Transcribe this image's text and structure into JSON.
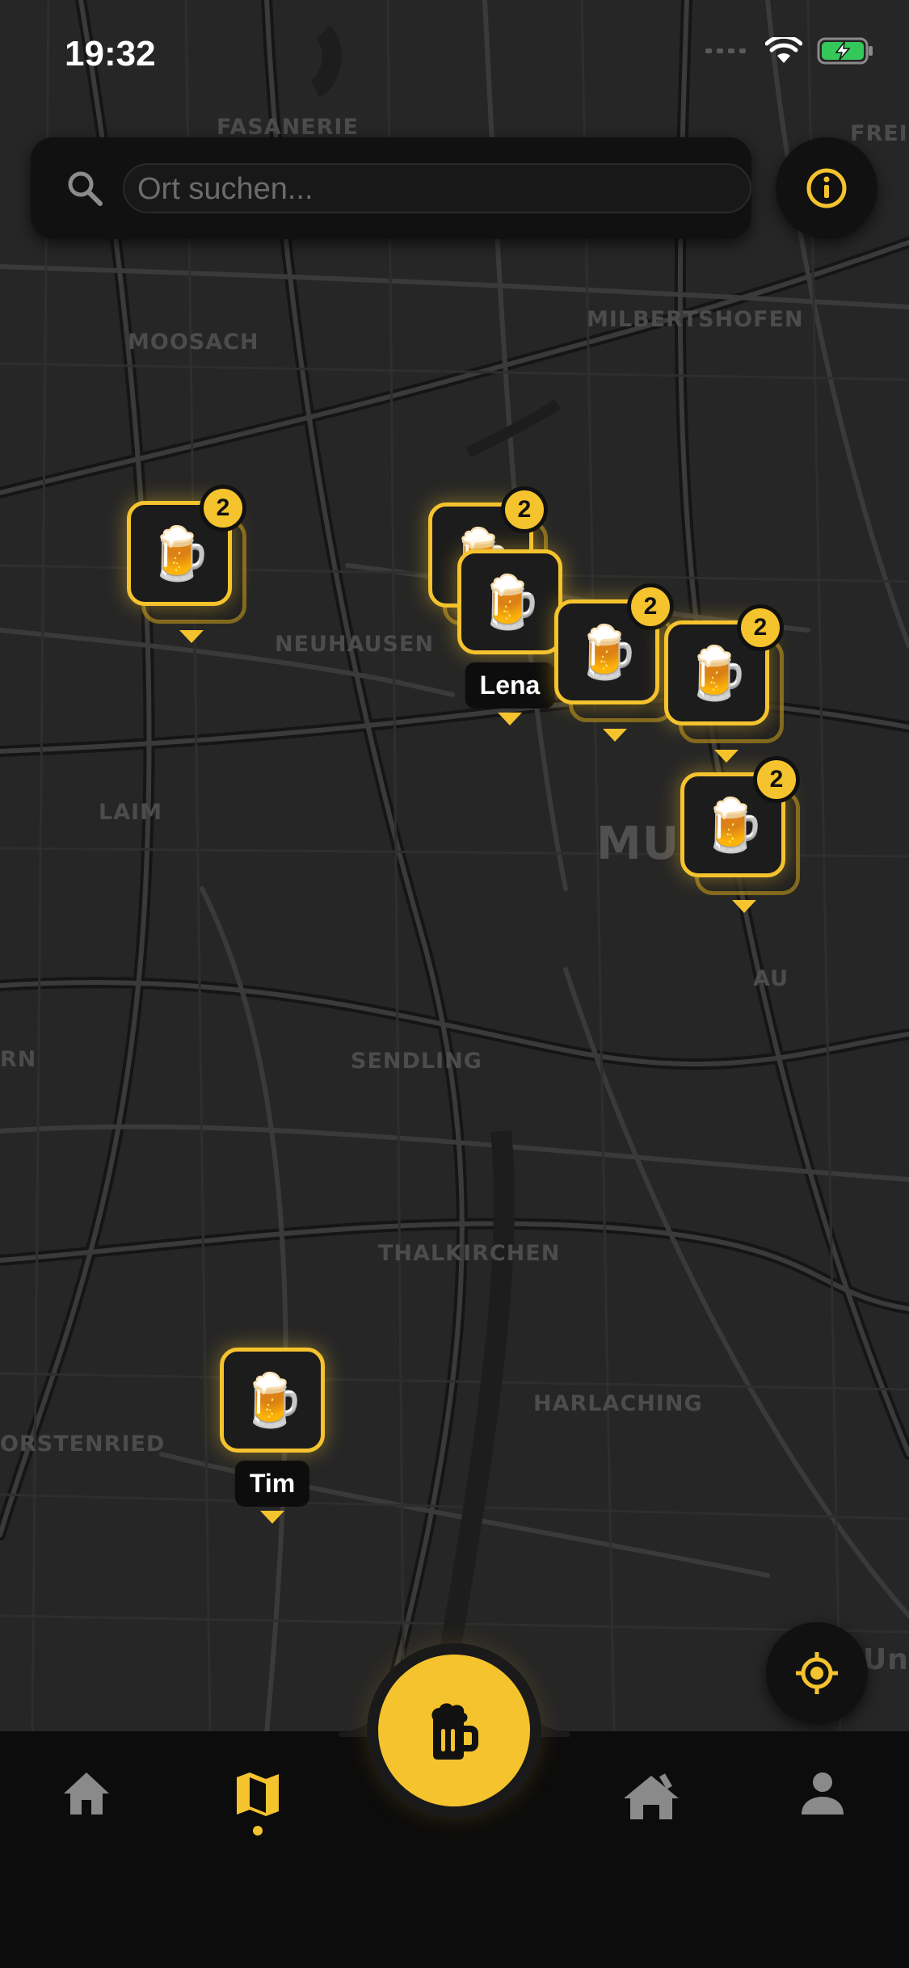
{
  "status_bar": {
    "time": "19:32"
  },
  "search": {
    "placeholder": "Ort suchen..."
  },
  "districts": {
    "fasanerie": "FASANERIE",
    "frei": "FREI",
    "milbertshofen": "MILBERTSHOFEN",
    "moosach": "MOOSACH",
    "neuhausen": "NEUHAUSEN",
    "laim": "LAIM",
    "mu": "MU",
    "au": "AU",
    "rn": "RN",
    "sendling": "SENDLING",
    "thalkirchen": "THALKIRCHEN",
    "harlaching": "HARLACHING",
    "orstenried": "ORSTENRIED",
    "unt": "Unt"
  },
  "markers": [
    {
      "emoji": "🍺",
      "badge": "2"
    },
    {
      "emoji": "🍺",
      "badge": "2"
    },
    {
      "emoji": "🍺",
      "name": "Lena"
    },
    {
      "emoji": "🍺",
      "badge": "2"
    },
    {
      "emoji": "🍺",
      "badge": "2"
    },
    {
      "emoji": "🍺",
      "badge": "2"
    },
    {
      "emoji": "🍺",
      "name": "Tim"
    }
  ],
  "tabs": [
    {
      "icon": "home-icon",
      "active": false
    },
    {
      "icon": "map-icon",
      "active": true
    },
    {
      "icon": "beer-icon",
      "active": false
    },
    {
      "icon": "bar-icon",
      "active": false
    },
    {
      "icon": "profile-icon",
      "active": false
    }
  ],
  "colors": {
    "accent": "#f5c32d",
    "background": "#0c0c0c",
    "map": "#262626"
  }
}
